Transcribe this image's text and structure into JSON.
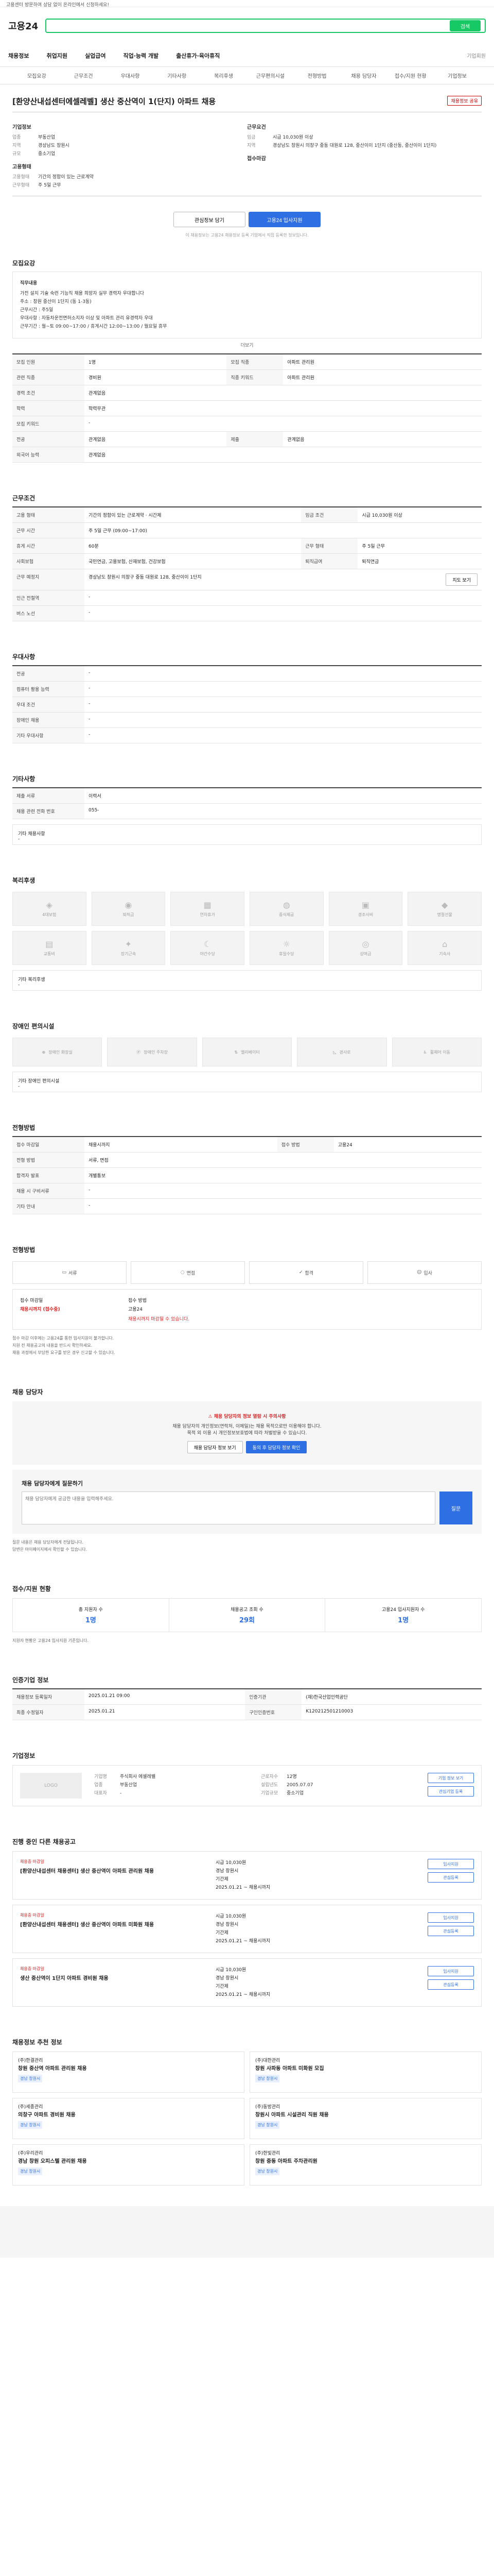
{
  "topbar": {
    "text": "고용센터 방문하여 상담 없이 온라인에서 신청하세요!"
  },
  "header": {
    "logo": "고용24",
    "search_button": "검색"
  },
  "gnb": {
    "items": [
      "채용정보",
      "취업지원",
      "실업급여",
      "직업·능력 개발",
      "출산휴가·육아휴직"
    ],
    "right": "기업회원"
  },
  "tabs": [
    "모집요강",
    "근무조건",
    "우대사항",
    "기타사항",
    "복리후생",
    "근무편의시설",
    "전형방법",
    "채용 담당자",
    "접수/지원 현황",
    "기업정보"
  ],
  "job": {
    "title": "[환양산내섭센터에셀레벨] 생산 중산역이 1(단지) 아파트 채용",
    "share": "채용정보 공유",
    "company_label": "기업정보",
    "company_rows": [
      {
        "k": "업종",
        "v": "부동산업"
      },
      {
        "k": "지역",
        "v": "경상남도 창원시"
      },
      {
        "k": "규모",
        "v": "중소기업"
      }
    ],
    "work_label": "근무요건",
    "work_rows": [
      {
        "k": "임금",
        "v": "시급 10,030원 이상"
      },
      {
        "k": "지역",
        "v": "경상남도 창원시 의창구 중동 대원로 128, 중산이이 1단지 (중산동, 중산이이 1단지)"
      }
    ],
    "condition_label": "고용형태",
    "condition_rows": [
      {
        "k": "고용형태",
        "v": "기간의 정함이 있는 근로계약"
      },
      {
        "k": "근무형태",
        "v": "주 5일 근무"
      }
    ],
    "deadline_label": "접수마감",
    "btn_interest": "관심정보 담기",
    "btn_apply": "고용24 입사지원",
    "note": "이 채용정보는 고용24 채용정보 등록 기업에서 직접 등록한 정보입니다."
  },
  "recruit": {
    "heading": "모집요강",
    "desc_title": "직무내용",
    "desc_lines": [
      "가전 설치 기술 숙련 기능직 채용 희망자 실무 경력자 우대합니다",
      "주소 : 창원 중산이 1단지 (동 1-3동)",
      "근무시간 : 주5일",
      "우대사항 : 자동차운전면허소지자 이상 및 아파트 관리 유경력자 우대",
      "근무기간 : 월~토 09:00~17:00 / 휴게시간 12:00~13:00 / 월요일 휴무"
    ],
    "more": "더보기",
    "rows": [
      {
        "k": "모집 인원",
        "v": "1명",
        "k2": "모집 직종",
        "v2": "아파트 관리원"
      },
      {
        "k": "관련 직종",
        "v": "경비원",
        "k2": "직종 키워드",
        "v2": "아파트 관리원"
      },
      {
        "k": "경력 조건",
        "v": "관계없음",
        "k2": "",
        "v2": ""
      },
      {
        "k": "학력",
        "v": "학력무관",
        "k2": "",
        "v2": ""
      },
      {
        "k": "모집 키워드",
        "v": "-",
        "k2": "",
        "v2": ""
      },
      {
        "k": "전공",
        "v": "관계없음",
        "k2": "제출",
        "v2": "관계없음"
      },
      {
        "k": "외국어 능력",
        "v": "관계없음",
        "k2": "",
        "v2": ""
      }
    ]
  },
  "work": {
    "heading": "근무조건",
    "rows": [
      {
        "k": "고용 형태",
        "v": "기간의 정함이 있는 근로계약 · 시간제",
        "k2": "임금 조건",
        "v2": "시급 10,030원 이상"
      },
      {
        "k": "근무 시간",
        "v": "주 5일 근무 (09:00~17:00)",
        "k2": "",
        "v2": ""
      },
      {
        "k": "휴게 시간",
        "v": "60분",
        "k2": "근무 형태",
        "v2": "주 5일 근무"
      },
      {
        "k": "사회보험",
        "v": "국민연금, 고용보험, 산재보험, 건강보험",
        "k2": "퇴직급여",
        "v2": "퇴직연금"
      },
      {
        "k": "근무 예정지",
        "v": "경상남도 창원시 의창구 중동 대원로 128, 중산이이 1단지",
        "k2": "",
        "v2": ""
      },
      {
        "k": "인근 전철역",
        "v": "-",
        "k2": "",
        "v2": ""
      },
      {
        "k": "버스 노선",
        "v": "-",
        "k2": "",
        "v2": ""
      }
    ],
    "map_button": "지도 보기"
  },
  "prefer": {
    "heading": "우대사항",
    "rows": [
      {
        "k": "전공",
        "v": "-"
      },
      {
        "k": "컴퓨터 활용 능력",
        "v": "-"
      },
      {
        "k": "우대 조건",
        "v": "-"
      },
      {
        "k": "장애인 채용",
        "v": "-"
      },
      {
        "k": "기타 우대사항",
        "v": "-"
      }
    ]
  },
  "etc": {
    "heading": "기타사항",
    "rows": [
      {
        "k": "제출 서류",
        "v": "이력서"
      },
      {
        "k": "채용 관련 전화 번호",
        "v": "055-"
      }
    ],
    "extra_label": "기타 채용사항",
    "extra_value": "-"
  },
  "welfare": {
    "heading": "복리후생",
    "items": [
      "4대보험",
      "퇴직금",
      "연차휴가",
      "중식제공",
      "경조사비",
      "명절선물",
      "교통비",
      "장기근속",
      "야간수당",
      "휴일수당",
      "상여금",
      "기숙사"
    ],
    "etc_label": "기타 복리후생",
    "etc_value": "-"
  },
  "facility": {
    "heading": "장애인 편의시설",
    "items": [
      "장애인 화장실",
      "장애인 주차장",
      "엘리베이터",
      "경사로",
      "휠체어 이동"
    ],
    "etc_label": "기타 장애인 편의시설",
    "etc_value": "-"
  },
  "screen": {
    "heading": "전형방법",
    "rows": [
      {
        "k": "접수 마감일",
        "v": "채용시까지",
        "k2": "접수 방법",
        "v2": "고용24"
      },
      {
        "k": "전형 방법",
        "v": "서류, 면접",
        "k2": "",
        "v2": ""
      },
      {
        "k": "합격자 발표",
        "v": "개별통보",
        "k2": "",
        "v2": ""
      },
      {
        "k": "채용 시 구비서류",
        "v": "-",
        "k2": "",
        "v2": ""
      },
      {
        "k": "기타 안내",
        "v": "-",
        "k2": "",
        "v2": ""
      }
    ]
  },
  "procedure": {
    "heading": "전형방법",
    "steps": [
      "서류",
      "면접",
      "합격",
      "입사"
    ],
    "apply_label": "접수 마감일",
    "apply_value": "채용시까지 (접수중)",
    "method_label": "접수 방법",
    "method_value": "고용24",
    "warn": "채용시까지 마감될 수 있습니다.",
    "bullets": [
      "접수 마감 이후에는 고용24를 통한 입사지원이 불가합니다.",
      "지원 전 채용공고의 내용을 반드시 확인하세요.",
      "채용 과정에서 부당한 요구를 받은 경우 신고할 수 있습니다."
    ]
  },
  "contact": {
    "heading": "채용 담당자",
    "warn": "채용 담당자의 정보 열람 시 주의사항",
    "text1": "채용 담당자의 개인정보(연락처, 이메일)는 채용 목적으로만 이용해야 합니다.",
    "text2": "목적 외 이용 시 개인정보보호법에 따라 처벌받을 수 있습니다.",
    "btn_view": "채용 담당자 정보 보기",
    "btn_agree": "동의 후 담당자 정보 확인"
  },
  "qna": {
    "heading": "채용 담당자에게 질문하기",
    "placeholder": "채용 담당자에게 궁금한 내용을 입력해주세요.",
    "send": "질문",
    "bullets": [
      "질문 내용은 채용 담당자에게 전달됩니다.",
      "답변은 마이페이지에서 확인할 수 있습니다."
    ]
  },
  "status": {
    "heading": "접수/지원 현황",
    "cells": [
      {
        "label": "총 지원자 수",
        "value": "1명"
      },
      {
        "label": "채용공고 조회 수",
        "value": "29회"
      },
      {
        "label": "고용24 입사지원자 수",
        "value": "1명"
      }
    ],
    "note": "지원자 현황은 고용24 입사지원 기준입니다."
  },
  "info": {
    "heading": "인증기업 정보",
    "rows": [
      {
        "k": "채용정보 등록일자",
        "v": "2025.01.21 09:00",
        "k2": "인증기관",
        "v2": "(재)한국산업인력공단"
      },
      {
        "k": "최종 수정일자",
        "v": "2025.01.21",
        "k2": "구인인증번호",
        "v2": "K120212501210003"
      }
    ]
  },
  "company": {
    "heading": "기업정보",
    "logo": "LOGO",
    "rows": [
      {
        "k": "기업명",
        "v": "주식회사 에셀레벨"
      },
      {
        "k": "업종",
        "v": "부동산업"
      },
      {
        "k": "대표자",
        "v": "-"
      },
      {
        "k": "근로자수",
        "v": "12명"
      },
      {
        "k": "설립년도",
        "v": "2005.07.07"
      },
      {
        "k": "기업규모",
        "v": "중소기업"
      }
    ],
    "btn1": "기업 정보 보기",
    "btn2": "관심기업 등록"
  },
  "other": {
    "heading": "진행 중인 다른 채용공고",
    "jobs": [
      {
        "badge": "채용중 마감일",
        "title": "[환양산내섭센터 채용센터] 생산 중산역이 아파트 관리원 채용",
        "pay": "시급 10,030원",
        "area": "경남 창원시",
        "type": "기간제",
        "date": "2025.01.21 ~ 채용시까지"
      },
      {
        "badge": "채용중 마감일",
        "title": "[환양산내섭센터 채용센터] 생산 중산역이 아파트 미화원 채용",
        "pay": "시급 10,030원",
        "area": "경남 창원시",
        "type": "기간제",
        "date": "2025.01.21 ~ 채용시까지"
      },
      {
        "badge": "채용중 마감일",
        "title": "생산 중산역이 1단지 아파트 경비원 채용",
        "pay": "시급 10,030원",
        "area": "경남 창원시",
        "type": "기간제",
        "date": "2025.01.21 ~ 채용시까지"
      }
    ],
    "btn_apply": "입사지원",
    "btn_interest": "관심등록"
  },
  "recommend": {
    "heading": "채용정보 추천 정보",
    "items": [
      {
        "company": "(주)한결관리",
        "title": "창원 중산역 아파트 관리원 채용",
        "tag": "경남 창원시"
      },
      {
        "company": "(주)대한관리",
        "title": "창원 사파동 아파트 미화원 모집",
        "tag": "경남 창원시"
      },
      {
        "company": "(주)세종관리",
        "title": "의창구 아파트 경비원 채용",
        "tag": "경남 창원시"
      },
      {
        "company": "(주)동방관리",
        "title": "창원시 아파트 시설관리 직원 채용",
        "tag": "경남 창원시"
      },
      {
        "company": "(주)우리관리",
        "title": "경남 창원 오피스텔 관리원 채용",
        "tag": "경남 창원시"
      },
      {
        "company": "(주)한빛관리",
        "title": "창원 중동 아파트 주차관리원",
        "tag": "경남 창원시"
      }
    ]
  },
  "colors": {
    "accent": "#2f6fe4",
    "brand": "#17c964",
    "alert": "#d22222"
  }
}
